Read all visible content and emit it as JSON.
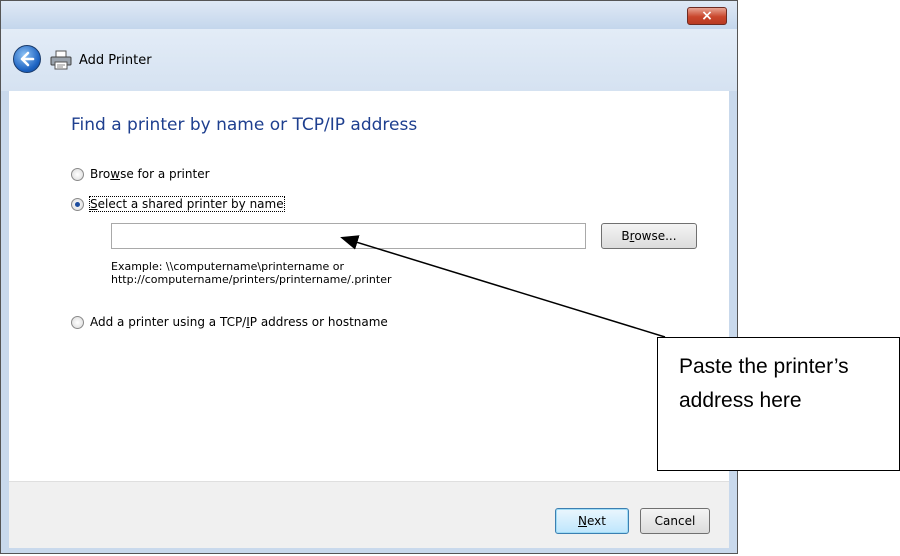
{
  "window": {
    "title": "Add Printer",
    "close_label": "×"
  },
  "wizard": {
    "heading": "Find a printer by name or TCP/IP address",
    "options": [
      {
        "pre": "Bro",
        "key": "w",
        "post": "se for a printer",
        "checked": false
      },
      {
        "pre": "",
        "key": "S",
        "post": "elect a shared printer by name",
        "checked": true
      },
      {
        "pre": "Add a printer using a TCP/",
        "key": "I",
        "post": "P address or hostname",
        "checked": false
      }
    ],
    "name_input_value": "",
    "browse": {
      "pre": "B",
      "key": "r",
      "post": "owse..."
    },
    "example_line1": "Example: \\\\computername\\printername or",
    "example_line2": "http://computername/printers/printername/.printer"
  },
  "footer": {
    "next": {
      "pre": "",
      "key": "N",
      "post": "ext"
    },
    "cancel_label": "Cancel"
  },
  "callout": {
    "text": "Paste the printer’s address here"
  },
  "colors": {
    "heading": "#1e3f8f",
    "accent": "#1d63c2"
  }
}
